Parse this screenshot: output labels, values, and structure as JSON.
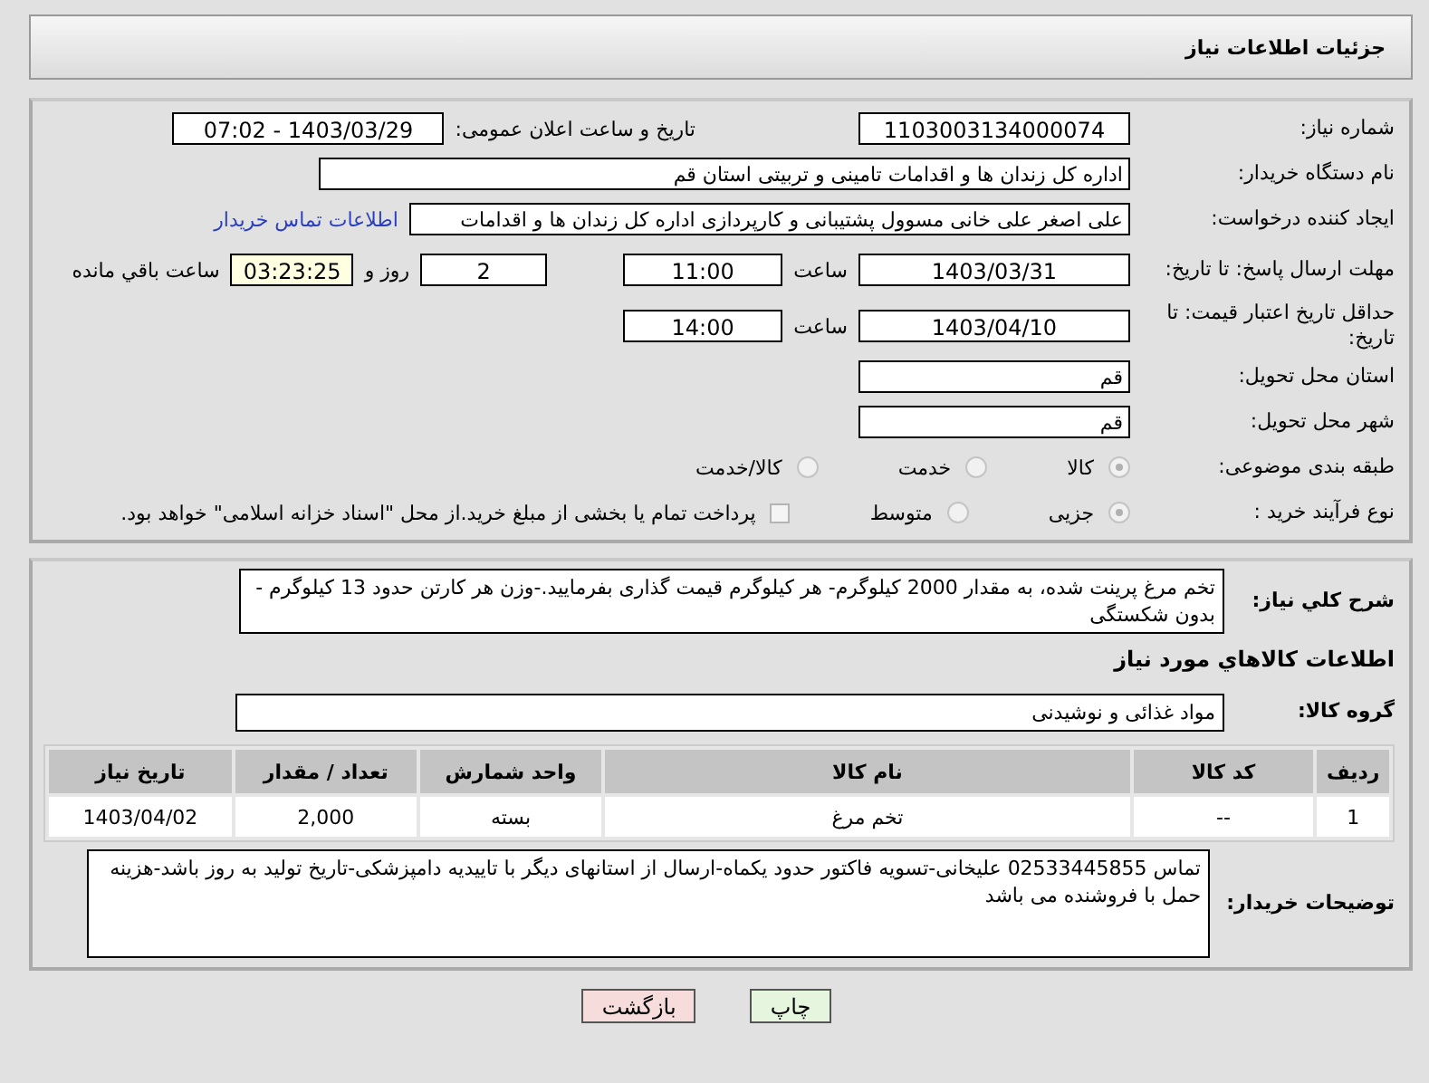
{
  "header": {
    "title": "جزئیات اطلاعات نیاز"
  },
  "need_number": {
    "label": "شماره نیاز:",
    "value": "1103003134000074"
  },
  "announce": {
    "label": "تاریخ و ساعت اعلان عمومی:",
    "value": "1403/03/29 - 07:02"
  },
  "buyer": {
    "label": "نام دستگاه خریدار:",
    "value": "اداره کل زندان ها و اقدامات تامینی و تربیتی استان قم"
  },
  "creator": {
    "label": "ایجاد کننده درخواست:",
    "value": "علی اصغر علی خانی مسوول پشتیبانی و کارپردازی اداره کل زندان ها و اقدامات",
    "link": "اطلاعات تماس خریدار"
  },
  "deadline": {
    "label": "مهلت ارسال پاسخ: تا تاریخ:",
    "date": "1403/03/31",
    "time_label": "ساعت",
    "time": "11:00",
    "days": "2",
    "days_label": "روز و",
    "remaining": "03:23:25",
    "remaining_label": "ساعت باقي مانده"
  },
  "validity": {
    "label": "حداقل تاریخ اعتبار قیمت: تا تاریخ:",
    "date": "1403/04/10",
    "time_label": "ساعت",
    "time": "14:00"
  },
  "province": {
    "label": "استان محل تحویل:",
    "value": "قم"
  },
  "city": {
    "label": "شهر محل تحویل:",
    "value": "قم"
  },
  "category": {
    "label": "طبقه بندی موضوعی:",
    "options": [
      {
        "label": "کالا",
        "selected": true
      },
      {
        "label": "خدمت",
        "selected": false
      },
      {
        "label": "کالا/خدمت",
        "selected": false
      }
    ]
  },
  "process": {
    "label": "نوع فرآیند خرید :",
    "options": [
      {
        "label": "جزیی",
        "selected": true
      },
      {
        "label": "متوسط",
        "selected": false
      }
    ],
    "treasury": {
      "label": "پرداخت تمام یا بخشی از مبلغ خرید.از محل \"اسناد خزانه اسلامی\" خواهد بود.",
      "checked": false
    }
  },
  "description": {
    "label": "شرح کلي نياز:",
    "value": "تخم مرغ پرینت شده، به مقدار 2000 کیلوگرم- هر کیلوگرم قیمت گذاری بفرمایید.-وزن هر کارتن حدود 13 کیلوگرم - بدون شکستگی"
  },
  "goods_heading": "اطلاعات کالاهاي مورد نياز",
  "goods_group": {
    "label": "گروه کالا:",
    "value": "مواد غذائی و نوشیدنی"
  },
  "table": {
    "columns": [
      "ردیف",
      "کد کالا",
      "نام کالا",
      "واحد شمارش",
      "تعداد / مقدار",
      "تاریخ نیاز"
    ],
    "rows": [
      [
        "1",
        "--",
        "تخم مرغ",
        "بسته",
        "2,000",
        "1403/04/02"
      ]
    ]
  },
  "buyer_notes": {
    "label": "توضیحات خریدار:",
    "value": "تماس 02533445855 علیخانی-تسویه فاکتور حدود یکماه-ارسال از استانهای دیگر  با تاییدیه دامپزشکی-تاریخ تولید به روز باشد-هزینه حمل با فروشنده می باشد"
  },
  "buttons": [
    {
      "label": "چاپ",
      "kind": "print"
    },
    {
      "label": "بازگشت",
      "kind": "back"
    }
  ]
}
